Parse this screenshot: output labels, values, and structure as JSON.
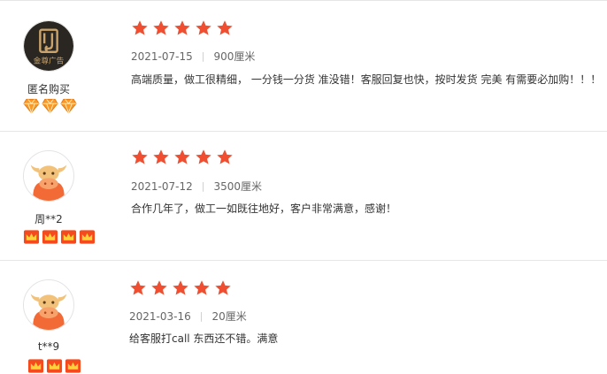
{
  "colors": {
    "star": "#f04e30",
    "divider": "#e6e6e6",
    "diamond": "#f79a2a",
    "crown_badge": "#f44a1e"
  },
  "reviews": [
    {
      "user": "匿名购买",
      "avatar": "jinzun-logo-avatar",
      "avatar_text": "金尊广告",
      "rating": 5,
      "badge_type": "diamond-icon",
      "badge_count": 3,
      "date": "2021-07-15",
      "separator": "|",
      "spec": "900厘米",
      "content": "高端质量，做工很精细， 一分钱一分货 准没错！客服回复也快，按时发货 完美 有需要必加购！！！"
    },
    {
      "user": "周**2",
      "avatar": "bull-avatar",
      "rating": 5,
      "badge_type": "crown-badge-icon",
      "badge_count": 4,
      "date": "2021-07-12",
      "separator": "|",
      "spec": "3500厘米",
      "content": "合作几年了，做工一如既往地好，客户非常满意，感谢！"
    },
    {
      "user": "t**9",
      "avatar": "bull-avatar",
      "rating": 5,
      "badge_type": "crown-badge-icon",
      "badge_count": 3,
      "date": "2021-03-16",
      "separator": "|",
      "spec": "20厘米",
      "content": "给客服打call 东西还不错。满意"
    }
  ]
}
